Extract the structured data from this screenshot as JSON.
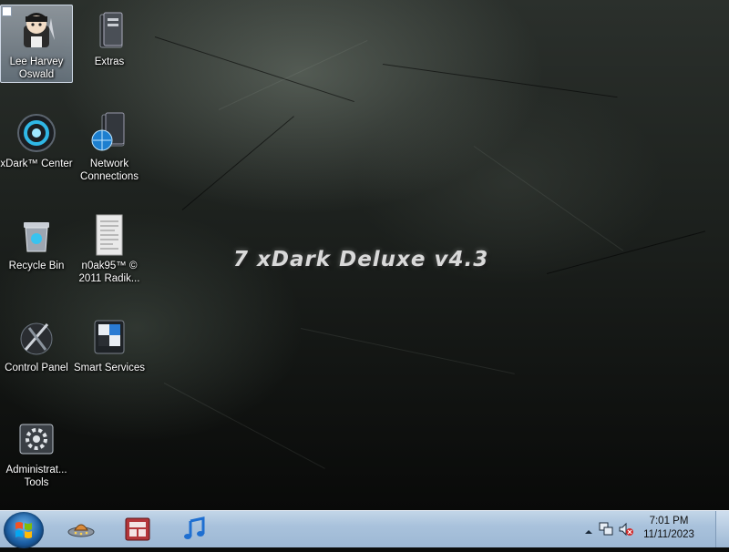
{
  "desktop": {
    "watermark": "7 xDark Deluxe v4.3",
    "icons": [
      {
        "label": "Lee Harvey\nOswald",
        "icon": "user-avatar-icon",
        "selected": true
      },
      {
        "label": "Extras",
        "icon": "folder-icon"
      },
      {
        "label": "xDark™ Center",
        "icon": "xdark-center-icon"
      },
      {
        "label": "Network\nConnections",
        "icon": "network-icon"
      },
      {
        "label": "Recycle Bin",
        "icon": "recycle-bin-icon"
      },
      {
        "label": "n0ak95™ ©\n2011 Radik...",
        "icon": "document-icon"
      },
      {
        "label": "Control Panel",
        "icon": "control-panel-icon"
      },
      {
        "label": "Smart Services",
        "icon": "smart-services-icon"
      },
      {
        "label": "Administrat...\nTools",
        "icon": "admin-tools-icon"
      }
    ]
  },
  "taskbar": {
    "pinned": [
      "ufo-icon",
      "media-center-icon",
      "music-note-icon"
    ],
    "clock": {
      "time": "7:01 PM",
      "date": "11/11/2023"
    },
    "tray": [
      "show-hidden-icons-arrow",
      "network-tray-icon",
      "volume-muted-icon"
    ]
  },
  "colors": {
    "taskbar": "#a9c2dc",
    "desktop": "#1c201d",
    "selection": "#b9c9dd"
  }
}
